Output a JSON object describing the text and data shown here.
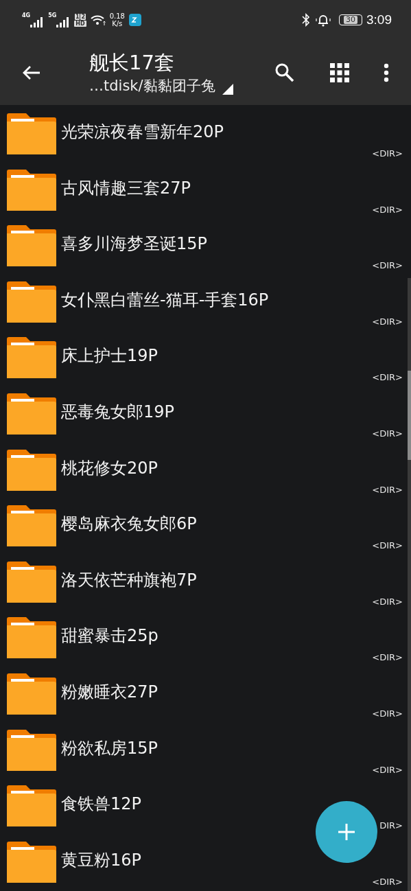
{
  "status_bar": {
    "network_1": "4G",
    "network_2": "5G",
    "sim_1": "1",
    "sim_2": "2",
    "hd": "HD",
    "speed": "0.18",
    "speed_unit": "K/s",
    "battery": "30",
    "time": "3:09"
  },
  "toolbar": {
    "title": "舰长17套",
    "path": "…tdisk/黏黏团子兔"
  },
  "files": [
    {
      "name": "光荣凉夜春雪新年20P",
      "type": "<DIR>"
    },
    {
      "name": "古风情趣三套27P",
      "type": "<DIR>"
    },
    {
      "name": "喜多川海梦圣诞15P",
      "type": "<DIR>"
    },
    {
      "name": "女仆黑白蕾丝-猫耳-手套16P",
      "type": "<DIR>"
    },
    {
      "name": "床上护士19P",
      "type": "<DIR>"
    },
    {
      "name": "恶毒兔女郎19P",
      "type": "<DIR>"
    },
    {
      "name": "桃花修女20P",
      "type": "<DIR>"
    },
    {
      "name": "樱岛麻衣兔女郎6P",
      "type": "<DIR>"
    },
    {
      "name": "洛天依芒种旗袍7P",
      "type": "<DIR>"
    },
    {
      "name": "甜蜜暴击25p",
      "type": "<DIR>"
    },
    {
      "name": "粉嫩睡衣27P",
      "type": "<DIR>"
    },
    {
      "name": "粉欲私房15P",
      "type": "<DIR>"
    },
    {
      "name": "食铁兽12P",
      "type": "DIR>"
    },
    {
      "name": "黄豆粉16P",
      "type": "<DIR>"
    }
  ]
}
